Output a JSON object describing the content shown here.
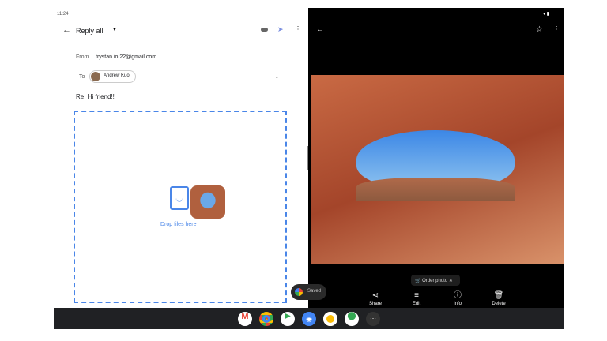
{
  "status": {
    "time": "11:24"
  },
  "compose": {
    "title": "Reply all",
    "from_label": "From",
    "from": "trystan.io.22@gmail.com",
    "to_label": "To",
    "to": "Andrew Kuo",
    "subject": "Re: Hi friend!!",
    "drop_text": "Drop files here"
  },
  "photos": {
    "order": "Order photo",
    "actions": [
      "Share",
      "Edit",
      "Info",
      "Delete"
    ]
  },
  "toast": "Saved",
  "taskbar": {
    "apps": [
      "gmail",
      "chrome",
      "play-store",
      "camera",
      "photos",
      "maps",
      "app-launcher"
    ]
  }
}
